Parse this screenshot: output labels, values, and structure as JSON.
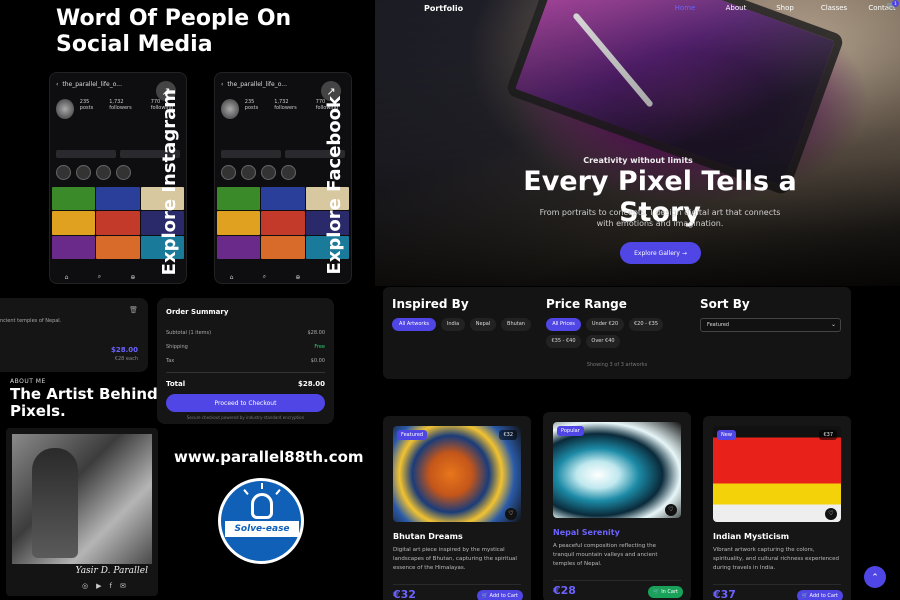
{
  "social": {
    "title_line1": "Word Of People On",
    "title_line2": "Social Media",
    "phones": [
      {
        "handle": "the_parallel_life_o...",
        "cta": "Explore Instagram",
        "stats": [
          "235 posts",
          "1,732 followers",
          "770 following"
        ]
      },
      {
        "handle": "the_parallel_life_o...",
        "cta": "Explore Facebook",
        "stats": [
          "235 posts",
          "1,732 followers",
          "770 following"
        ]
      }
    ]
  },
  "cart": {
    "item_desc": "ncient temples of Nepal.",
    "item_price": "$28.00",
    "item_each": "€28 each"
  },
  "order_summary": {
    "title": "Order Summary",
    "rows": [
      {
        "label": "Subtotal (1 items)",
        "value": "$28.00"
      },
      {
        "label": "Shipping",
        "value": "Free"
      },
      {
        "label": "Tax",
        "value": "$0.00"
      }
    ],
    "total_label": "Total",
    "total_value": "$28.00",
    "checkout_label": "Proceed to Checkout",
    "secure_note": "Secure checkout powered by industry-standard encryption"
  },
  "about": {
    "label": "ABOUT ME",
    "title_line1": "The Artist Behind T",
    "title_line2": "Pixels.",
    "signature": "Yasir D. Parallel"
  },
  "website": "www.parallel88th.com",
  "logo_text": "Solve-ease",
  "nav": {
    "brand": "Portfolio",
    "links": [
      "Home",
      "About",
      "Shop",
      "Classes",
      "Contact"
    ],
    "cart_count": "1"
  },
  "hero": {
    "subtitle": "Creativity without limits",
    "title": "Every Pixel Tells a Story",
    "description_line1": "From portraits to concepts, I design digital art that connects",
    "description_line2": "with emotions and imagination.",
    "cta": "Explore Gallery →"
  },
  "filters": {
    "inspired_title": "Inspired By",
    "inspired_chips": [
      "All Artworks",
      "India",
      "Nepal",
      "Bhutan"
    ],
    "price_title": "Price Range",
    "price_chips": [
      "All Prices",
      "Under €20",
      "€20 - €35",
      "€35 - €40",
      "Over €40"
    ],
    "sort_title": "Sort By",
    "sort_value": "Featured",
    "showing": "Showing 3 of 3 artworks"
  },
  "cards": [
    {
      "badge": "Featured",
      "price_tag": "€32",
      "title": "Bhutan Dreams",
      "desc": "Digital art piece inspired by the mystical landscapes of Bhutan, capturing the spiritual essence of the Himalayas.",
      "price": "€32",
      "button": "Add to Cart"
    },
    {
      "badge": "Popular",
      "price_tag": "",
      "title": "Nepal Serenity",
      "desc": "A peaceful composition reflecting the tranquil mountain valleys and ancient temples of Nepal.",
      "price": "€28",
      "button": "In Cart"
    },
    {
      "badge": "New",
      "price_tag": "€37",
      "title": "Indian Mysticism",
      "desc": "Vibrant artwork capturing the colors, spirituality, and cultural richness experienced during travels in India.",
      "price": "€37",
      "button": "Add to Cart"
    }
  ],
  "colors": {
    "accent": "#4f46e5",
    "in_cart": "#19a35a",
    "shipping_free": "#2ecc71"
  }
}
